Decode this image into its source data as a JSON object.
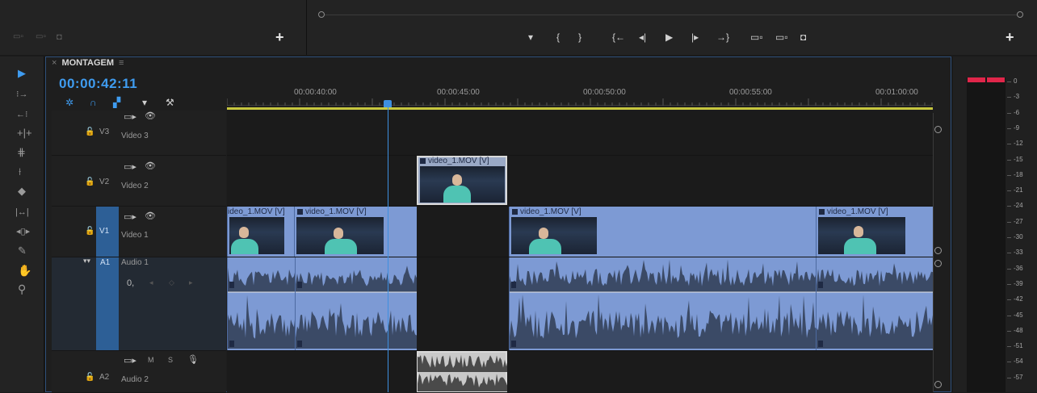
{
  "sequence": {
    "name": "MONTAGEM",
    "timecode": "00:00:42:11"
  },
  "ruler": {
    "labels": [
      "00:00:40:00",
      "00:00:45:00",
      "00:00:50:00",
      "00:00:55:00",
      "00:01:00:00"
    ]
  },
  "tracks": {
    "v3": {
      "id": "V3",
      "name": "Video 3"
    },
    "v2": {
      "id": "V2",
      "name": "Video 2"
    },
    "v1": {
      "id": "V1",
      "name": "Video 1"
    },
    "a1": {
      "id": "A1",
      "name": "Audio 1",
      "volume": "0,"
    },
    "a2": {
      "id": "A2",
      "name": "Audio 2",
      "mute": "M",
      "solo": "S"
    }
  },
  "clips": {
    "v2_clip": "video_1.MOV [V]",
    "v1_clip_1": "ideo_1.MOV [V]",
    "v1_clip_2": "video_1.MOV [V]",
    "v1_clip_3": "video_1.MOV [V]",
    "v1_clip_4": "video_1.MOV [V]"
  },
  "meter": {
    "scale": [
      "0",
      "-3",
      "-6",
      "-9",
      "-12",
      "-15",
      "-18",
      "-21",
      "-24",
      "-27",
      "-30",
      "-33",
      "-36",
      "-39",
      "-42",
      "-45",
      "-48",
      "-51",
      "-54",
      "-57"
    ]
  },
  "colors": {
    "accent": "#3f9cf0",
    "clip": "#7d9ad4",
    "work_area": "#c6c63e",
    "peak": "#e0264a",
    "track_highlight": "#2d5f96"
  },
  "icons": {
    "toolbar": [
      "selection-tool-icon",
      "track-select-icon",
      "ripple-edit-icon",
      "rolling-edit-icon",
      "rate-stretch-icon",
      "razor-icon",
      "slip-icon",
      "slide-icon",
      "pen-icon",
      "hand-icon",
      "zoom-icon"
    ],
    "transport": [
      "marker-icon",
      "mark-in-icon",
      "mark-out-icon",
      "go-to-in-icon",
      "step-back-icon",
      "play-icon",
      "step-forward-icon",
      "go-to-out-icon",
      "lift-icon",
      "extract-icon",
      "camera-icon"
    ]
  }
}
